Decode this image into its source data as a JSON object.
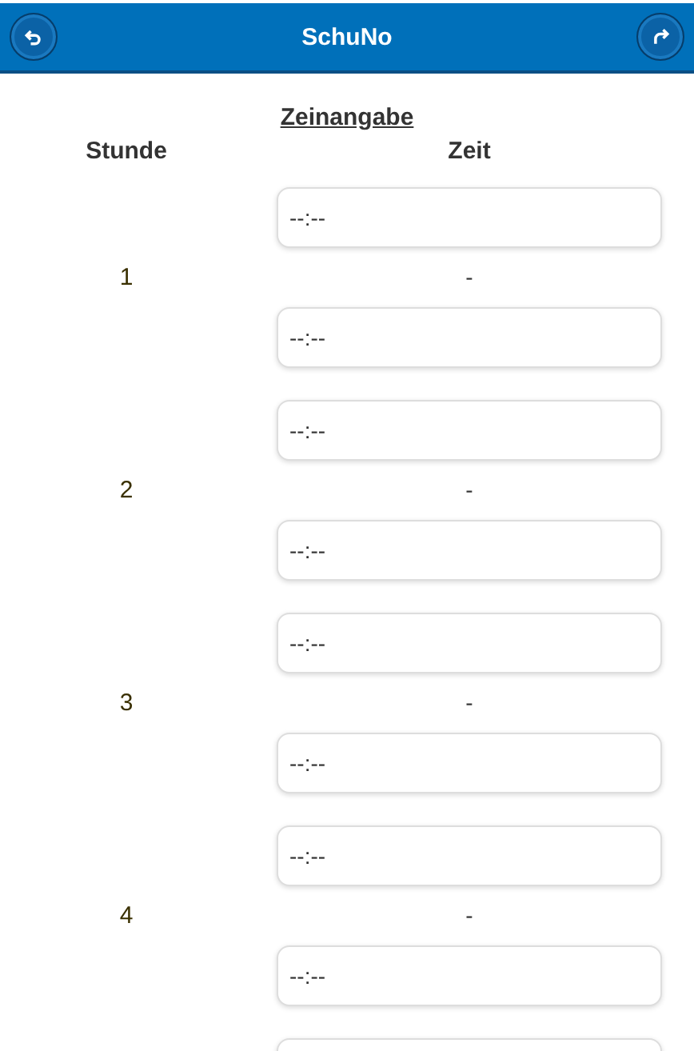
{
  "header": {
    "title": "SchuNo",
    "back_button": {
      "kind": "back"
    },
    "forward_button": {
      "kind": "forward"
    }
  },
  "section_title": "Zeinangabe",
  "columns": [
    "Stunde",
    "Zeit"
  ],
  "rows": [
    {
      "lesson": "1",
      "start": {
        "placeholder": "--:--"
      },
      "separator": "-",
      "end": {
        "placeholder": "--:--"
      }
    },
    {
      "lesson": "2",
      "start": {
        "placeholder": "--:--"
      },
      "separator": "-",
      "end": {
        "placeholder": "--:--"
      }
    },
    {
      "lesson": "3",
      "start": {
        "placeholder": "--:--"
      },
      "separator": "-",
      "end": {
        "placeholder": "--:--"
      }
    },
    {
      "lesson": "4",
      "start": {
        "placeholder": "--:--"
      },
      "separator": "-",
      "end": {
        "placeholder": "--:--"
      }
    }
  ],
  "next_field": {
    "kind": "cut"
  }
}
